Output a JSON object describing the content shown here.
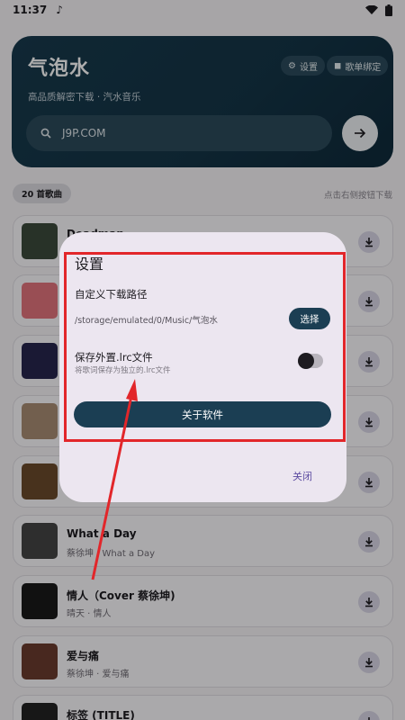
{
  "status": {
    "time": "11:37",
    "music_icon": "music-note-icon"
  },
  "header": {
    "title": "气泡水",
    "subtitle": "高品质解密下载 · 汽水音乐",
    "settings_chip": "设置",
    "playlist_chip": "歌单绑定",
    "search_value": "J9P.COM"
  },
  "list": {
    "count_label": "20 首歌曲",
    "hint": "点击右侧按钮下载",
    "songs": [
      {
        "title": "Deadman",
        "subtitle": "",
        "cover": "#3c4a3c"
      },
      {
        "title": "",
        "subtitle": "",
        "cover": "#e2737c"
      },
      {
        "title": "",
        "subtitle": "",
        "cover": "#27254d"
      },
      {
        "title": "",
        "subtitle": "",
        "cover": "#a88c73"
      },
      {
        "title": "",
        "subtitle": "",
        "cover": "#6a4a2c"
      },
      {
        "title": "What a Day",
        "subtitle": "蔡徐坤 · What a Day",
        "cover": "#444444"
      },
      {
        "title": "情人（Cover 蔡徐坤)",
        "subtitle": "晴天 · 情人",
        "cover": "#1a1a1a"
      },
      {
        "title": "爱与痛",
        "subtitle": "蔡徐坤 · 爱与痛",
        "cover": "#6b3b2f"
      },
      {
        "title": "标签 (TITLE)",
        "subtitle": "",
        "cover": "#222222"
      }
    ]
  },
  "dialog": {
    "title": "设置",
    "download_path_label": "自定义下载路径",
    "download_path_value": "/storage/emulated/0/Music/气泡水",
    "choose_button": "选择",
    "lrc_label": "保存外置.lrc文件",
    "lrc_desc": "将歌词保存为独立的.lrc文件",
    "lrc_enabled": false,
    "about_button": "关于软件",
    "close_button": "关闭"
  },
  "colors": {
    "header_bg": "#163648",
    "accent": "#1b3e53",
    "annotation": "#e2262a"
  }
}
